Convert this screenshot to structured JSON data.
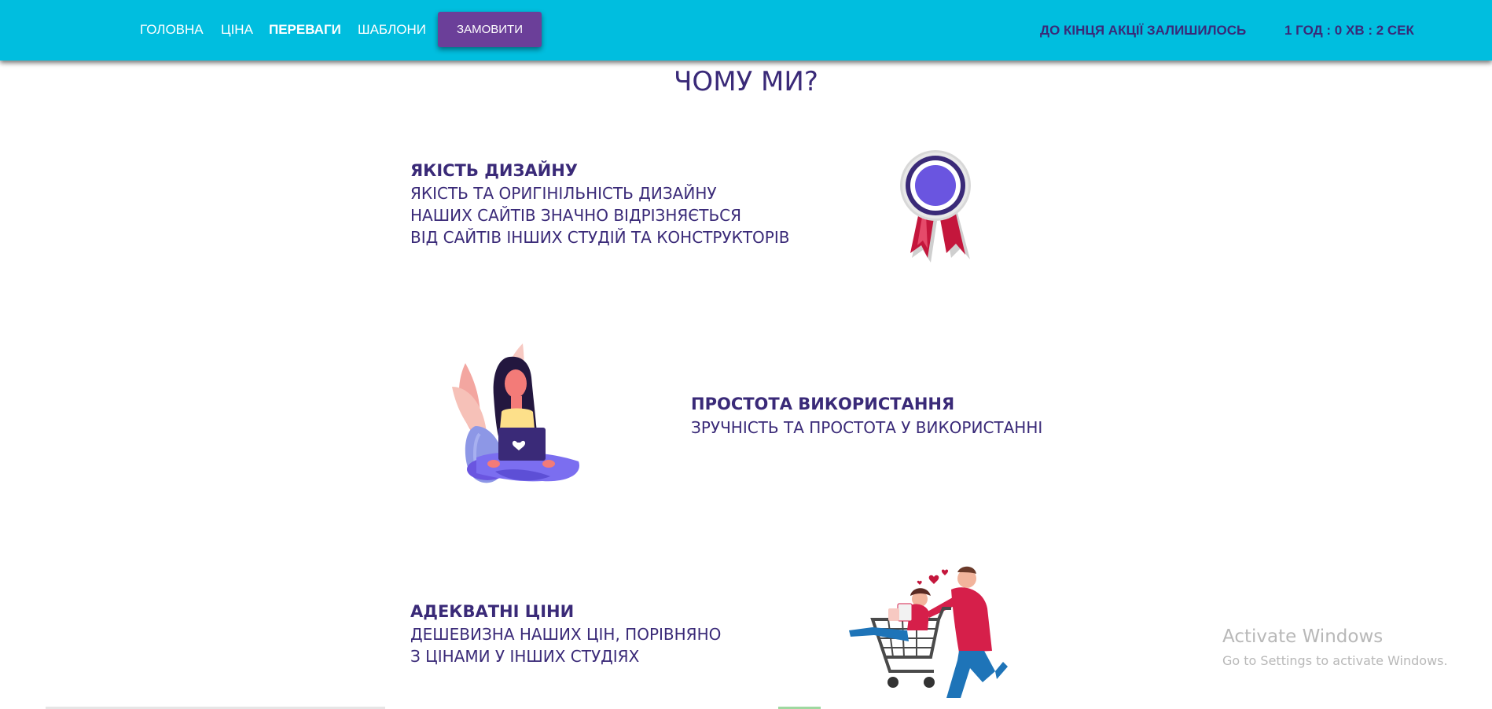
{
  "nav": {
    "items": [
      {
        "label": "ГОЛОВНА",
        "active": false
      },
      {
        "label": "ЦІНА",
        "active": false
      },
      {
        "label": "ПЕРЕВАГИ",
        "active": true
      },
      {
        "label": "ШАБЛОНИ",
        "active": false
      }
    ],
    "order_button": "ЗАМОВИТИ"
  },
  "countdown": {
    "label": "ДО КІНЦЯ АКЦІЇ ЗАЛИШИЛОСЬ",
    "value": "1 ГОД : 0 ХВ : 2 СЕК"
  },
  "section": {
    "title": "ЧОМУ МИ?"
  },
  "features": [
    {
      "heading": "ЯКІСТЬ ДИЗАЙНУ",
      "lines": [
        "ЯКІСТЬ ТА ОРИГІНІЛЬНІСТЬ ДИЗАЙНУ",
        "НАШИХ САЙТІВ ЗНАЧНО ВІДРІЗНЯЄТЬСЯ",
        "ВІД САЙТІВ ІНШИХ СТУДІЙ ТА КОНСТРУКТОРІВ"
      ],
      "illustration": "award-rosette-icon"
    },
    {
      "heading": "ПРОСТОТА ВИКОРИСТАННЯ",
      "lines": [
        "ЗРУЧНІСТЬ ТА ПРОСТОТА У ВИКОРИСТАННІ"
      ],
      "illustration": "woman-with-laptop-illustration"
    },
    {
      "heading": "АДЕКВАТНІ ЦІНИ",
      "lines": [
        "ДЕШЕВИЗНА НАШИХ ЦІН, ПОРІВНЯНО",
        "З ЦІНАМИ У ІНШИХ СТУДІЯХ"
      ],
      "illustration": "couple-shopping-cart-illustration"
    }
  ],
  "watermark": {
    "title": "Activate Windows",
    "subtitle": "Go to Settings to activate Windows."
  },
  "colors": {
    "header_bg": "#00bedf",
    "button_bg": "#6b3f99",
    "text_primary": "#3a2a78",
    "accent_red": "#c4163c",
    "accent_purple": "#6a55e0"
  }
}
